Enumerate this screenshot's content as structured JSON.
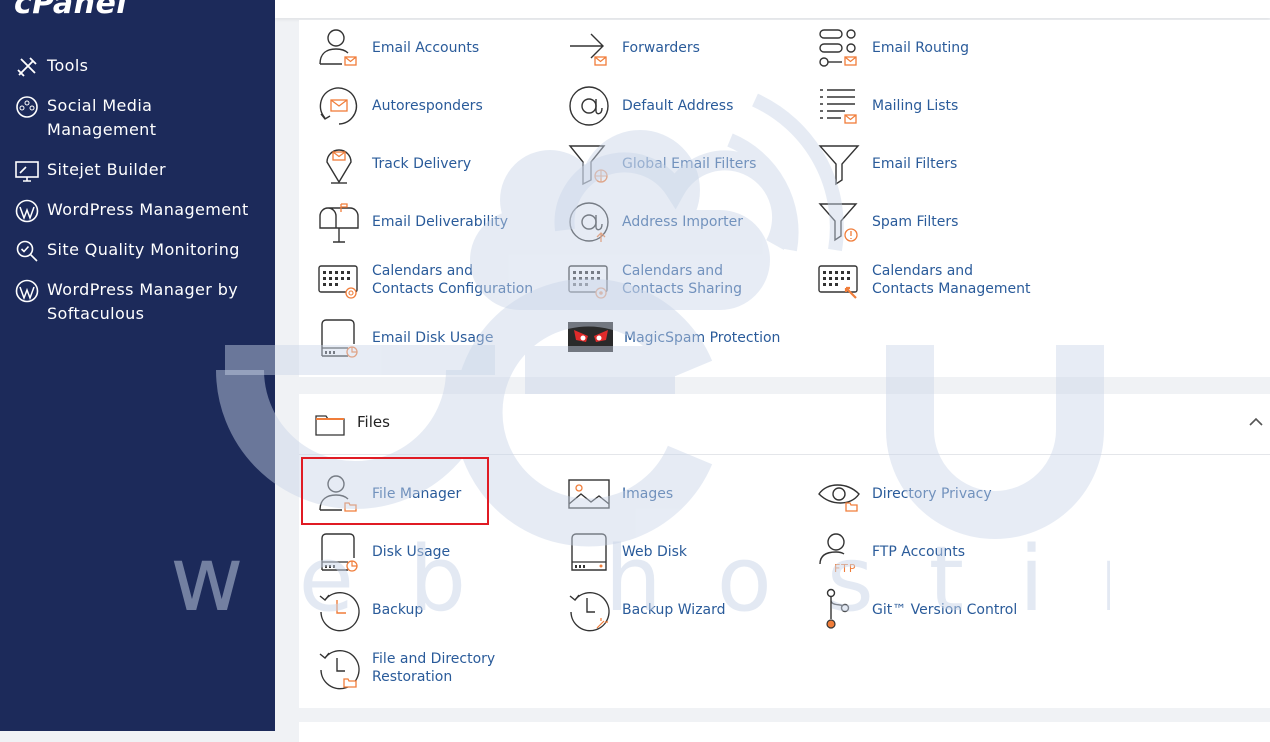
{
  "brand": {
    "logo_text": "cPanel"
  },
  "sidebar": {
    "items": [
      {
        "label": "Tools"
      },
      {
        "label": "Social Media Management"
      },
      {
        "label": "Sitejet Builder"
      },
      {
        "label": "WordPress Management"
      },
      {
        "label": "Site Quality Monitoring"
      },
      {
        "label": "WordPress Manager by Softaculous"
      }
    ]
  },
  "email_section": {
    "tools": [
      {
        "label": "Email Accounts",
        "icon": "user-mail-icon"
      },
      {
        "label": "Forwarders",
        "icon": "forward-arrow-icon"
      },
      {
        "label": "Email Routing",
        "icon": "routing-icon"
      },
      {
        "label": "Autoresponders",
        "icon": "autoresponder-icon"
      },
      {
        "label": "Default Address",
        "icon": "at-sign-icon"
      },
      {
        "label": "Mailing Lists",
        "icon": "list-icon"
      },
      {
        "label": "Track Delivery",
        "icon": "location-pin-icon"
      },
      {
        "label": "Global Email Filters",
        "icon": "globe-filter-icon"
      },
      {
        "label": "Email Filters",
        "icon": "funnel-icon"
      },
      {
        "label": "Email Deliverability",
        "icon": "mailbox-icon"
      },
      {
        "label": "Address Importer",
        "icon": "at-import-icon"
      },
      {
        "label": "Spam Filters",
        "icon": "spam-filter-icon"
      },
      {
        "label": "Calendars and Contacts Configuration",
        "icon": "calendar-at-icon"
      },
      {
        "label": "Calendars and Contacts Sharing",
        "icon": "calendar-gear-icon"
      },
      {
        "label": "Calendars and Contacts Management",
        "icon": "calendar-pen-icon"
      },
      {
        "label": "Email Disk Usage",
        "icon": "disk-usage-icon"
      },
      {
        "label": "MagicSpam Protection",
        "icon": "magicspam-icon"
      }
    ]
  },
  "files_section": {
    "title": "Files",
    "tools": [
      {
        "label": "File Manager",
        "icon": "user-folder-icon"
      },
      {
        "label": "Images",
        "icon": "image-icon"
      },
      {
        "label": "Directory Privacy",
        "icon": "eye-folder-icon"
      },
      {
        "label": "Disk Usage",
        "icon": "disk-usage-icon"
      },
      {
        "label": "Web Disk",
        "icon": "drive-icon"
      },
      {
        "label": "FTP Accounts",
        "icon": "ftp-user-icon"
      },
      {
        "label": "Backup",
        "icon": "backup-clock-icon"
      },
      {
        "label": "Backup Wizard",
        "icon": "backup-wizard-icon"
      },
      {
        "label": "Git™ Version Control",
        "icon": "git-branch-icon"
      },
      {
        "label": "File and Directory Restoration",
        "icon": "restore-icon"
      }
    ]
  },
  "colors": {
    "sidebar_bg": "#1c2a5a",
    "link": "#2a5b9a",
    "icon_accent": "#f07d3a",
    "highlight": "#e01b24"
  },
  "watermark": {
    "logo_text": "accu",
    "sub_text": "web hosting"
  }
}
